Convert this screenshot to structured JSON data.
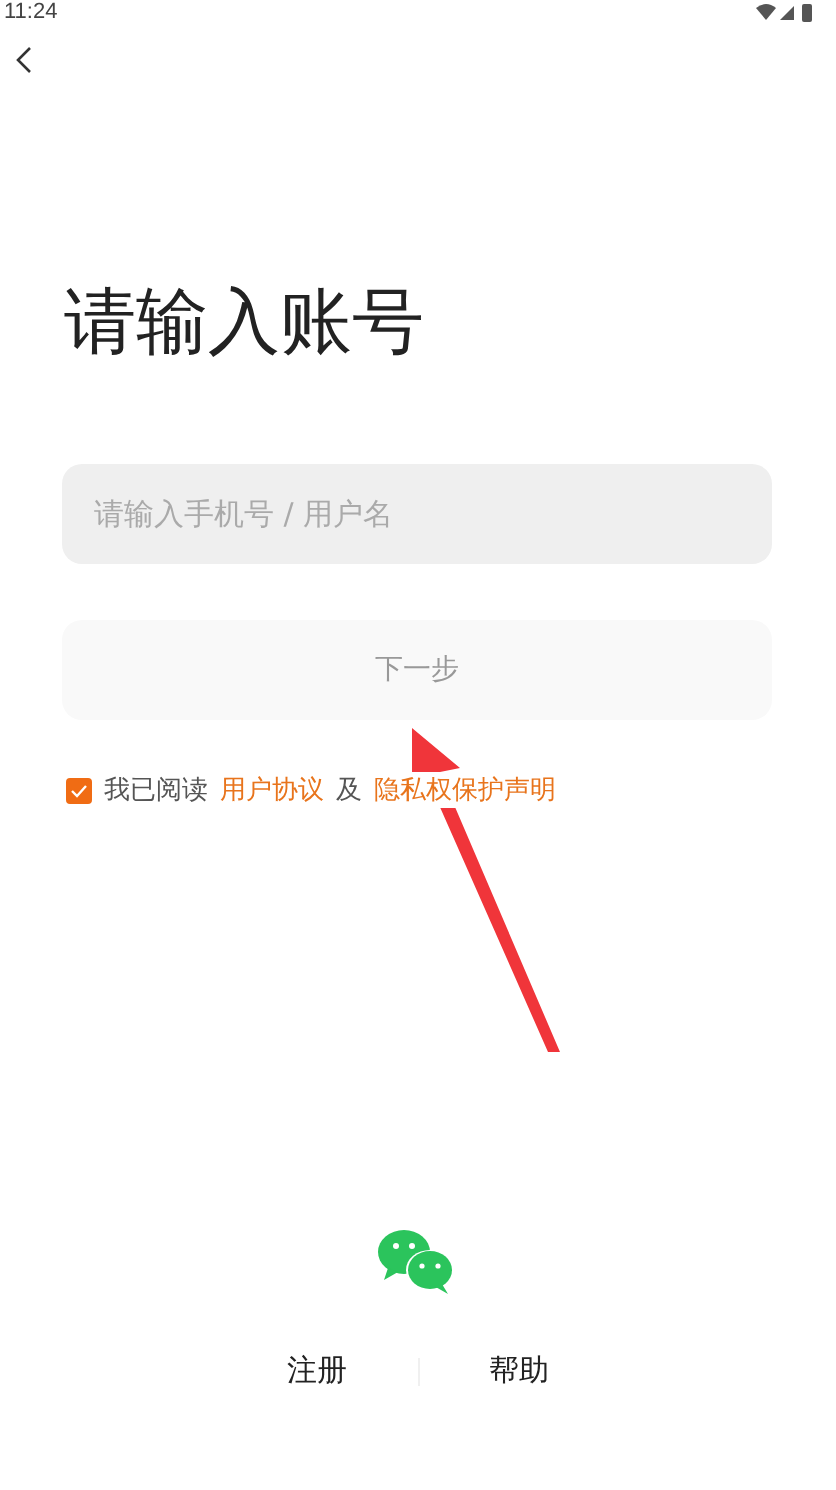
{
  "status_bar": {
    "time": "11:24"
  },
  "title": "请输入账号",
  "account_field": {
    "placeholder": "请输入手机号 / 用户名"
  },
  "next_button": {
    "label": "下一步",
    "disabled": true
  },
  "agreement": {
    "checked": true,
    "prefix": "我已阅读",
    "user_agreement": "用户协议",
    "conjunction": "及",
    "privacy_policy": "隐私权保护声明"
  },
  "footer_links": [
    {
      "label": "注册"
    },
    {
      "label": "帮助"
    }
  ]
}
